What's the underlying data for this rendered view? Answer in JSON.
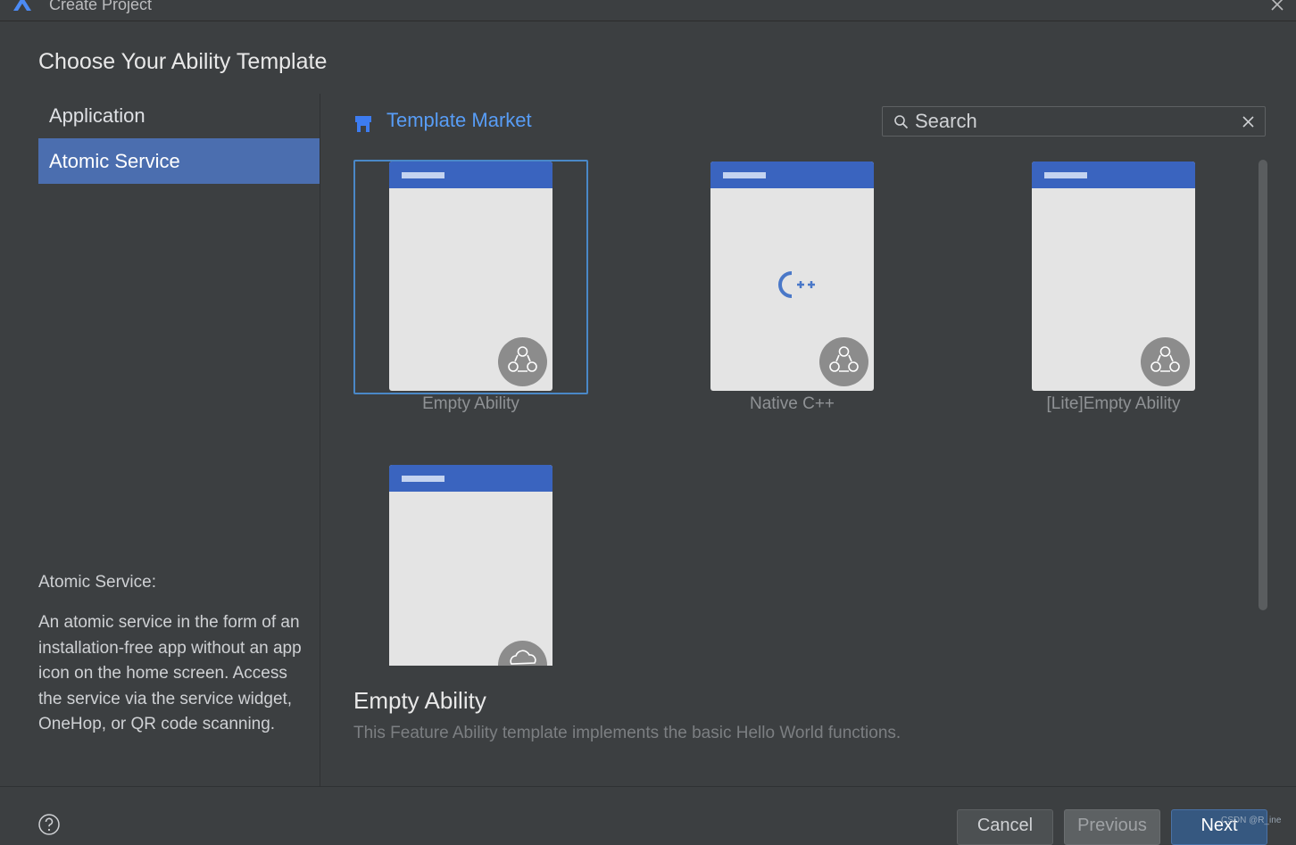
{
  "window": {
    "title": "Create Project",
    "logo_icon": "app-logo-icon",
    "close_icon": "close-icon"
  },
  "page": {
    "heading": "Choose Your Ability Template"
  },
  "categories": {
    "items": [
      {
        "label": "Application",
        "selected": false
      },
      {
        "label": "Atomic Service",
        "selected": true
      }
    ]
  },
  "category_description": {
    "title": "Atomic Service:",
    "body": "An atomic service in the form of an installation-free app without an app icon on the home screen. Access the service via the service widget, OneHop, or QR code scanning."
  },
  "template_market": {
    "label": "Template Market",
    "icon": "store-icon"
  },
  "search": {
    "value": "",
    "placeholder": "Search",
    "icon": "search-icon",
    "clear_icon": "clear-icon"
  },
  "templates": {
    "items": [
      {
        "label": "Empty Ability",
        "selected": true,
        "badge": "service-badge-icon"
      },
      {
        "label": "Native C++",
        "selected": false,
        "badge": "service-badge-icon",
        "glyph": "C++"
      },
      {
        "label": "[Lite]Empty Ability",
        "selected": false,
        "badge": "service-badge-icon"
      },
      {
        "label": "",
        "selected": false,
        "badge": "cloud-badge-icon"
      }
    ]
  },
  "detail": {
    "title": "Empty Ability",
    "description": "This Feature Ability template implements the basic Hello World functions."
  },
  "footer": {
    "help_icon": "help-icon",
    "cancel_label": "Cancel",
    "previous_label": "Previous",
    "next_label": "Next"
  },
  "watermark": "CSDN @R_ine",
  "colors": {
    "background": "#3c3f41",
    "selection": "#4b6eaf",
    "link": "#589df6",
    "card_header": "#3a64bf",
    "selected_border": "#4a88c7"
  }
}
